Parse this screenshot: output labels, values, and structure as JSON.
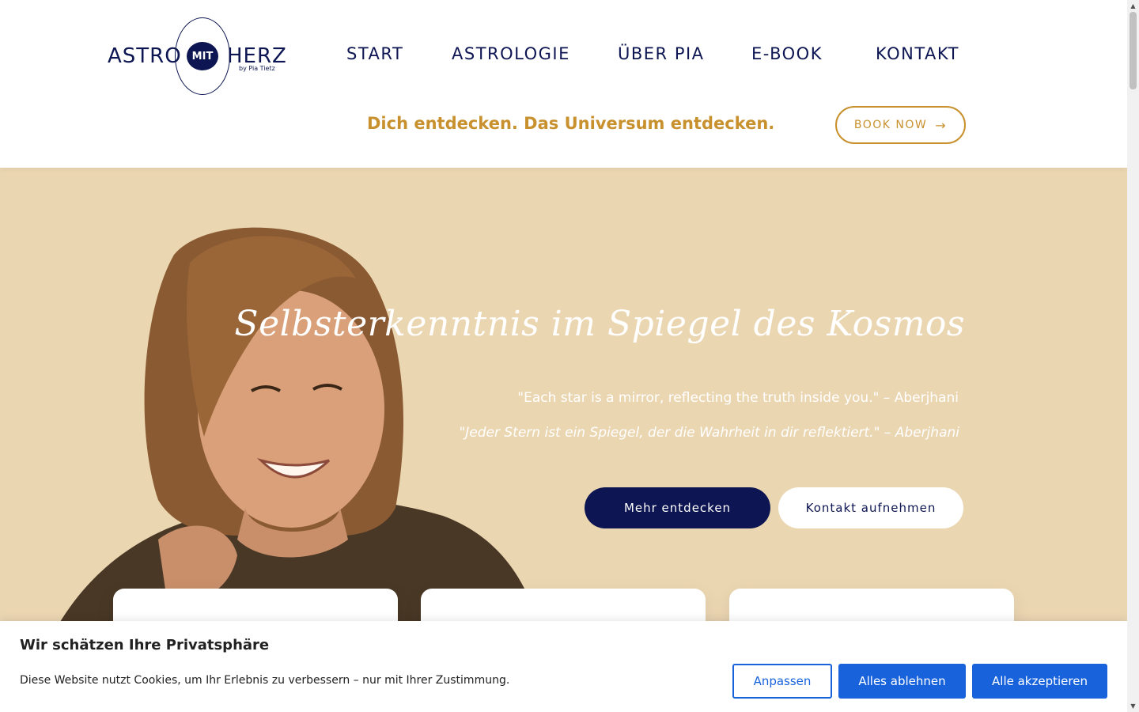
{
  "logo": {
    "left_text": "ASTRO",
    "badge_text": "MIT",
    "right_text": "HERZ",
    "byline": "by Pia Tietz"
  },
  "nav": {
    "items": [
      {
        "label": "START"
      },
      {
        "label": "ASTROLOGIE"
      },
      {
        "label": "ÜBER PIA"
      },
      {
        "label": "E-BOOK"
      },
      {
        "label": "KONTAKT"
      }
    ]
  },
  "header": {
    "tagline": "Dich entdecken. Das Universum entdecken.",
    "book_label": "BOOK NOW",
    "book_icon": "arrow-right-icon"
  },
  "hero": {
    "title": "Selbsterkenntnis im Spiegel des Kosmos",
    "quote_en": "\"Each star is a mirror, reflecting the truth inside you.\" – Aberjhani",
    "quote_de": "\"Jeder Stern ist ein Spiegel, der die Wahrheit in dir reflektiert.\" – Aberjhani",
    "primary_button": "Mehr entdecken",
    "secondary_button": "Kontakt aufnehmen"
  },
  "cookie": {
    "title": "Wir schätzen Ihre Privatsphäre",
    "text": "Diese Website nutzt Cookies, um Ihr Erlebnis zu verbessern – nur mit Ihrer Zustimmung.",
    "customize": "Anpassen",
    "reject": "Alles ablehnen",
    "accept": "Alle akzeptieren"
  },
  "colors": {
    "brand_navy": "#0d1652",
    "accent_gold": "#c8912e",
    "hero_bg": "#ebd6b2",
    "cookie_blue": "#1863dc"
  }
}
